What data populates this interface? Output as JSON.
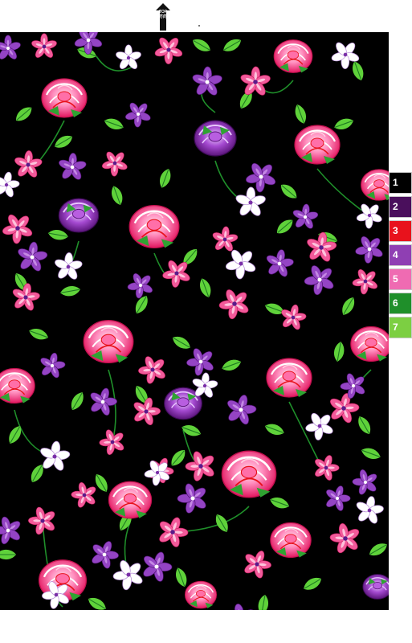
{
  "top_marker": {
    "label": "TOP",
    "sublabel": "方向",
    "icon": "up-arrow-icon"
  },
  "pattern": {
    "background_color": "#000000",
    "motifs": [
      "pink-rose",
      "purple-rose",
      "pink-blossom",
      "purple-violet",
      "white-blossom",
      "green-leaf"
    ]
  },
  "palette": [
    {
      "label": "1",
      "color": "#000000"
    },
    {
      "label": "2",
      "color": "#4a0f5c"
    },
    {
      "label": "3",
      "color": "#e8121c"
    },
    {
      "label": "4",
      "color": "#8f3fb3"
    },
    {
      "label": "5",
      "color": "#ef6bb2"
    },
    {
      "label": "6",
      "color": "#1f8f2a"
    },
    {
      "label": "7",
      "color": "#7ccf42"
    }
  ]
}
